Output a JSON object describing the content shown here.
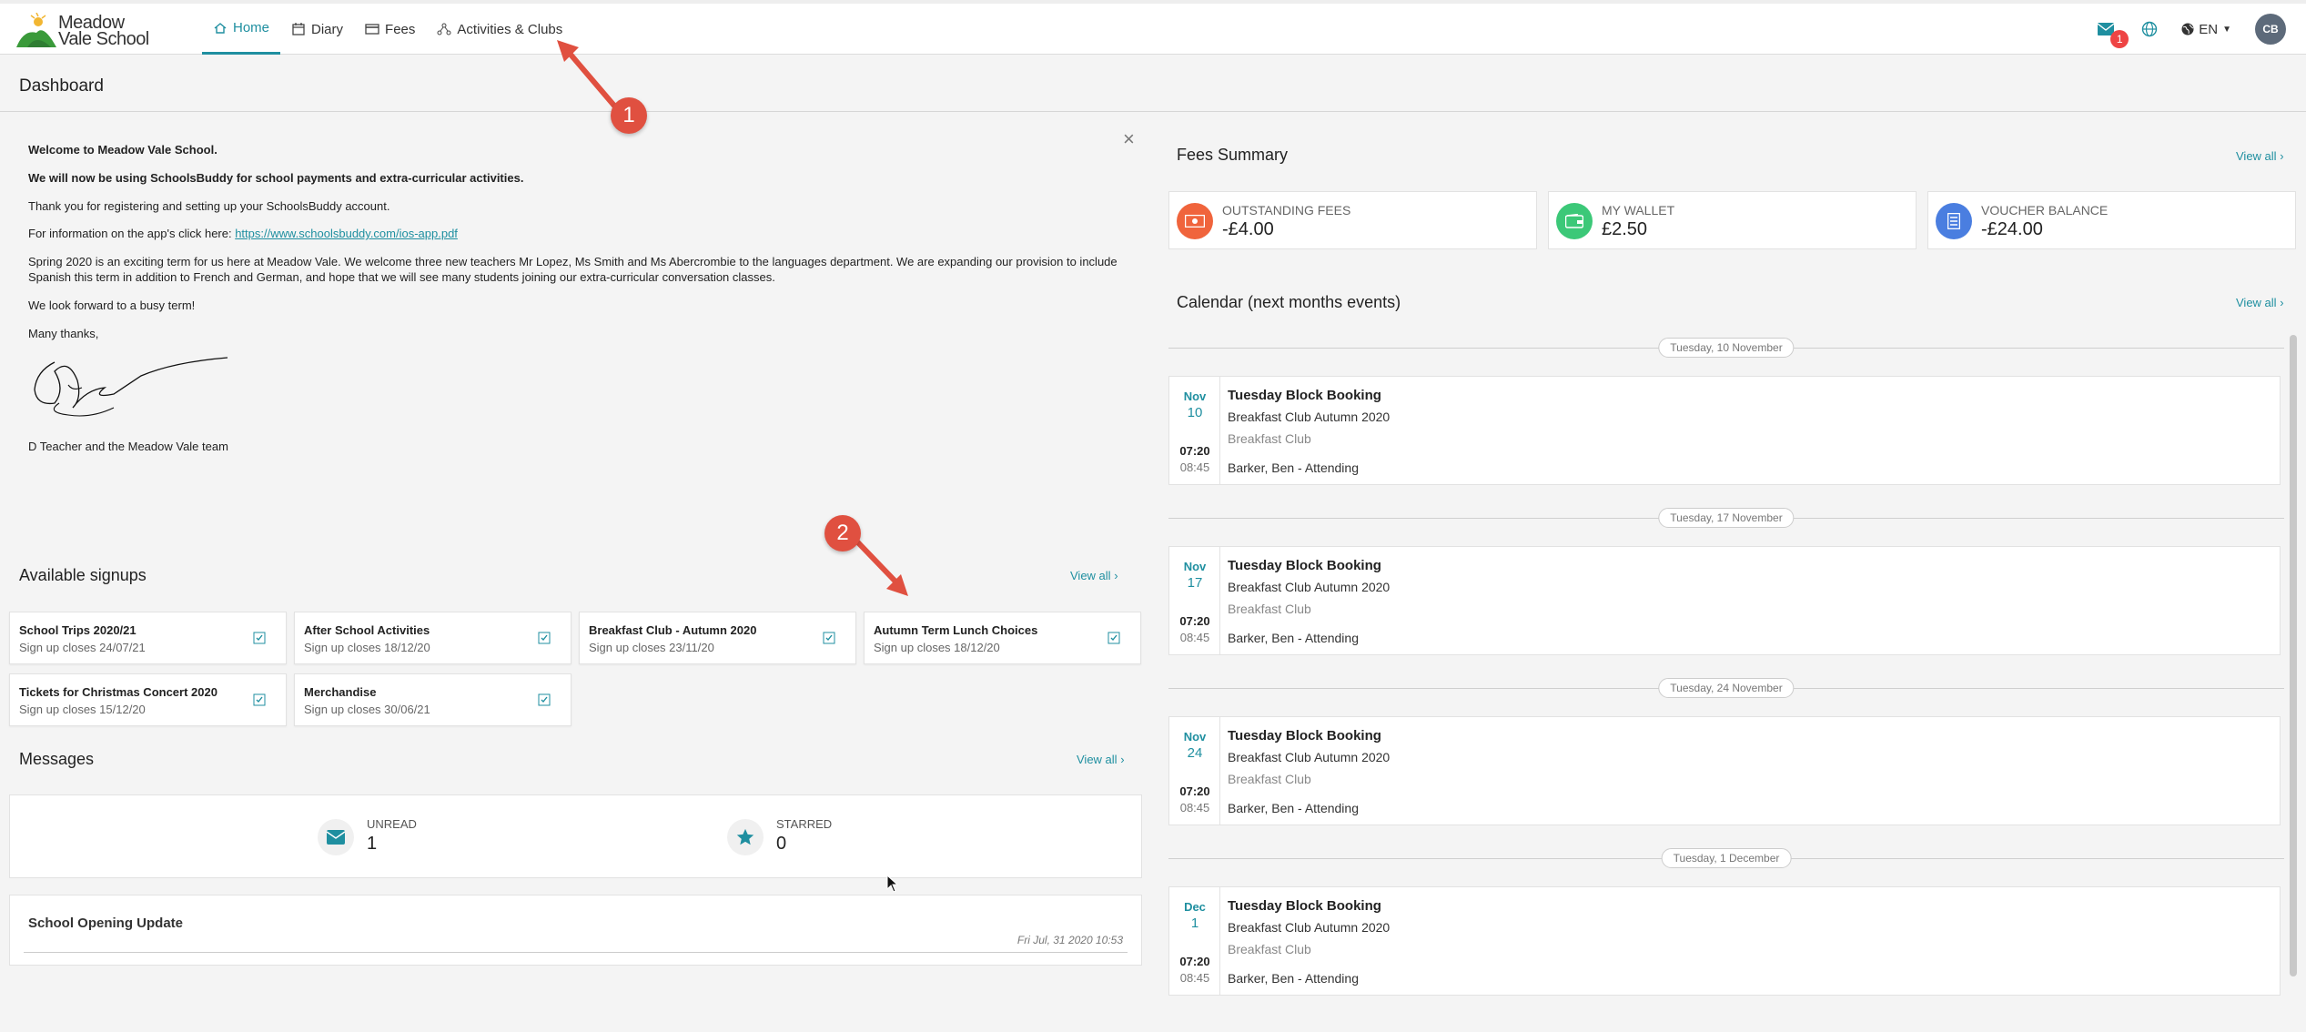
{
  "logo": {
    "line1": "Meadow",
    "line2": "Vale School"
  },
  "nav": {
    "items": [
      {
        "label": "Home",
        "icon": "home-icon",
        "active": true
      },
      {
        "label": "Diary",
        "icon": "calendar-icon",
        "active": false
      },
      {
        "label": "Fees",
        "icon": "card-icon",
        "active": false
      },
      {
        "label": "Activities & Clubs",
        "icon": "network-icon",
        "active": false
      }
    ],
    "mail_badge": "1",
    "language": "EN",
    "avatar": "CB"
  },
  "dashboard": {
    "title": "Dashboard"
  },
  "welcome": {
    "line1": "Welcome to Meadow Vale School.",
    "line2": "We will now be using SchoolsBuddy for school payments and extra-curricular activities.",
    "line3": "Thank you for registering and setting up your SchoolsBuddy account.",
    "line4_prefix": "For information on the app's click here: ",
    "line4_link": "https://www.schoolsbuddy.com/ios-app.pdf",
    "line5": "Spring 2020 is an exciting term for us here at Meadow Vale.  We welcome three new teachers Mr Lopez, Ms Smith and Ms Abercrombie to the languages department.  We are expanding our provision to include Spanish this term in addition to French and German, and hope that we will see many students joining our extra-curricular conversation classes.",
    "line6": "We look forward to a busy term!",
    "line7": "Many thanks,",
    "line8": "D Teacher and the Meadow Vale team"
  },
  "signups": {
    "title": "Available signups",
    "view_all": "View all",
    "items": [
      {
        "title": "School Trips 2020/21",
        "sub": "Sign up closes 24/07/21"
      },
      {
        "title": "After School Activities",
        "sub": "Sign up closes 18/12/20"
      },
      {
        "title": "Breakfast Club - Autumn 2020",
        "sub": "Sign up closes 23/11/20"
      },
      {
        "title": "Autumn Term Lunch Choices",
        "sub": "Sign up closes 18/12/20"
      },
      {
        "title": "Tickets for Christmas Concert 2020",
        "sub": "Sign up closes 15/12/20"
      },
      {
        "title": "Merchandise",
        "sub": "Sign up closes 30/06/21"
      }
    ]
  },
  "messages": {
    "title": "Messages",
    "view_all": "View all",
    "unread_label": "UNREAD",
    "unread_value": "1",
    "starred_label": "STARRED",
    "starred_value": "0",
    "items": [
      {
        "title": "School Opening Update",
        "date": "Fri Jul, 31 2020 10:53"
      }
    ]
  },
  "fees": {
    "title": "Fees Summary",
    "view_all": "View all",
    "cards": [
      {
        "label": "OUTSTANDING FEES",
        "value": "-£4.00",
        "color": "#f0643c",
        "icon": "money-icon"
      },
      {
        "label": "MY WALLET",
        "value": "£2.50",
        "color": "#3cc878",
        "icon": "wallet-icon"
      },
      {
        "label": "VOUCHER BALANCE",
        "value": "-£24.00",
        "color": "#4a7ee0",
        "icon": "voucher-icon"
      }
    ]
  },
  "calendar": {
    "title": "Calendar (next months events)",
    "view_all": "View all",
    "groups": [
      {
        "date": "Tuesday, 10 November",
        "mon": "Nov",
        "day": "10",
        "start": "07:20",
        "end": "08:45",
        "title": "Tuesday Block Booking",
        "subtitle": "Breakfast Club Autumn 2020",
        "club": "Breakfast Club",
        "attendee": "Barker, Ben - Attending"
      },
      {
        "date": "Tuesday, 17 November",
        "mon": "Nov",
        "day": "17",
        "start": "07:20",
        "end": "08:45",
        "title": "Tuesday Block Booking",
        "subtitle": "Breakfast Club Autumn 2020",
        "club": "Breakfast Club",
        "attendee": "Barker, Ben - Attending"
      },
      {
        "date": "Tuesday, 24 November",
        "mon": "Nov",
        "day": "24",
        "start": "07:20",
        "end": "08:45",
        "title": "Tuesday Block Booking",
        "subtitle": "Breakfast Club Autumn 2020",
        "club": "Breakfast Club",
        "attendee": "Barker, Ben - Attending"
      },
      {
        "date": "Tuesday, 1 December",
        "mon": "Dec",
        "day": "1",
        "start": "07:20",
        "end": "08:45",
        "title": "Tuesday Block Booking",
        "subtitle": "Breakfast Club Autumn 2020",
        "club": "Breakfast Club",
        "attendee": "Barker, Ben - Attending"
      }
    ]
  },
  "annotations": {
    "one": "1",
    "two": "2"
  },
  "colors": {
    "accent": "#1f8fa0",
    "annotation": "#e05040"
  }
}
